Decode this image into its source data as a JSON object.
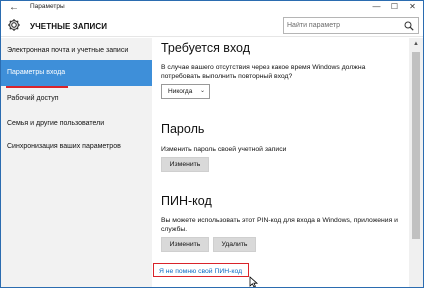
{
  "window": {
    "title": "Параметры",
    "back_glyph": "←",
    "minimize_glyph": "—",
    "maximize_glyph": "☐",
    "close_glyph": "✕"
  },
  "header": {
    "section_title": "УЧЕТНЫЕ ЗАПИСИ",
    "search_placeholder": "Найти параметр"
  },
  "sidebar": {
    "items": [
      {
        "label": "Электронная почта и учетные записи",
        "active": false
      },
      {
        "label": "Параметры входа",
        "active": true
      },
      {
        "label": "Рабочий доступ",
        "active": false
      },
      {
        "label": "Семья и другие пользователи",
        "active": false
      },
      {
        "label": "Синхронизация ваших параметров",
        "active": false
      }
    ]
  },
  "main": {
    "signin_required": {
      "heading": "Требуется вход",
      "description": "В случае вашего отсутствия через какое время Windows должна потребовать выполнить повторный вход?",
      "dropdown_value": "Никогда"
    },
    "password": {
      "heading": "Пароль",
      "description": "Изменить пароль своей учетной записи",
      "change_label": "Изменить"
    },
    "pin": {
      "heading": "ПИН-код",
      "description": "Вы можете использовать этот PIN-код для входа в Windows, приложения и службы.",
      "change_label": "Изменить",
      "remove_label": "Удалить",
      "forgot_link": "Я не помню свой ПИН-код"
    }
  },
  "colors": {
    "accent": "#3e8fd9",
    "highlight_red": "#d9232a",
    "link": "#0b6bc4",
    "sidebar_bg": "#f2f2f2"
  },
  "icons": [
    "back-arrow-icon",
    "gear-icon",
    "search-icon",
    "chevron-down-icon",
    "mouse-cursor-icon"
  ]
}
